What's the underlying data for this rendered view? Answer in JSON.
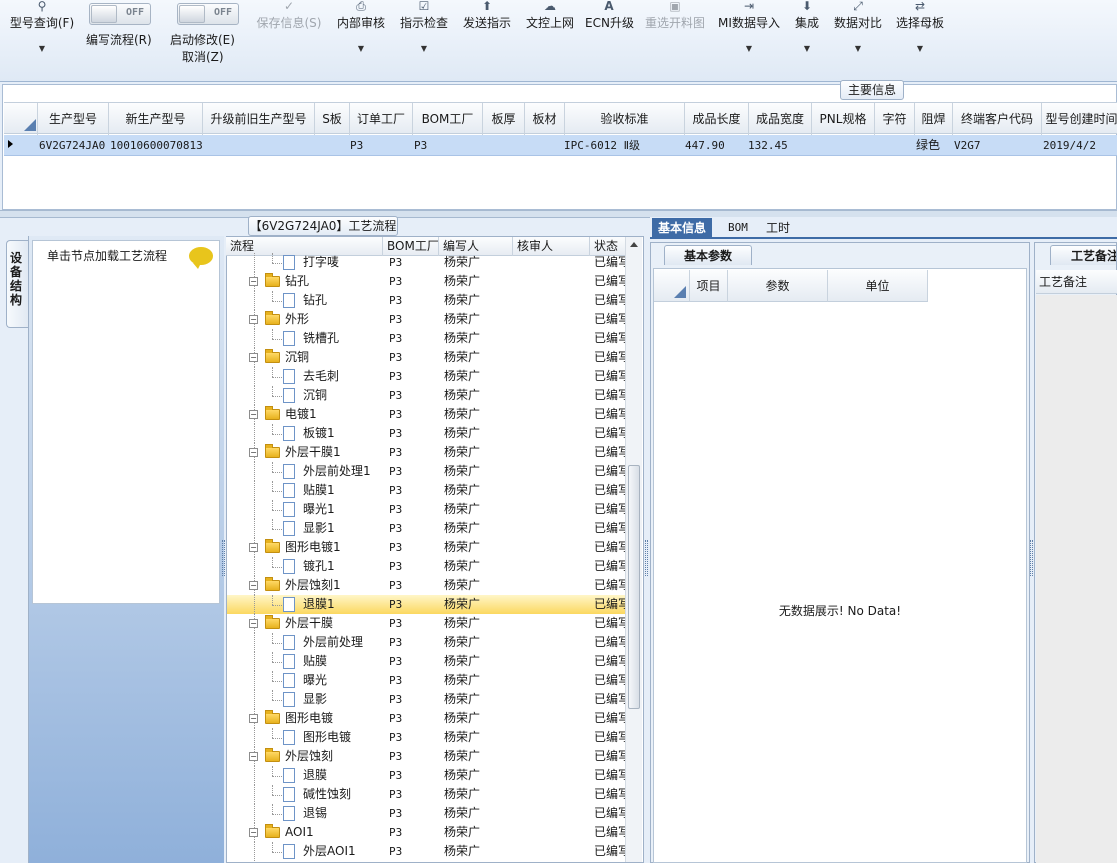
{
  "toolbar": {
    "query_model": "型号查询(F)",
    "write_flow_label": "编写流程(R)",
    "write_flow_toggle": "OFF",
    "start_modify_label": "启动修改(E)",
    "start_modify_toggle": "OFF",
    "cancel": "取消(Z)",
    "save_info": "保存信息(S)",
    "internal_review": "内部审核",
    "instruction_check": "指示检查",
    "send_instruction": "发送指示",
    "control_upload": "文控上网",
    "ecn_upgrade": "ECN升级",
    "reselect_cutting": "重选开料图",
    "mi_import": "MI数据导入",
    "integrate": "集成",
    "data_compare": "数据对比",
    "select_master": "选择母板"
  },
  "main_info": {
    "title": "主要信息",
    "columns": [
      "生产型号",
      "新生产型号",
      "升级前旧生产型号",
      "S板",
      "订单工厂",
      "BOM工厂",
      "板厚",
      "板材",
      "验收标准",
      "成品长度",
      "成品宽度",
      "PNL规格",
      "字符",
      "阻焊",
      "终端客户代码",
      "型号创建时间"
    ],
    "row": [
      "6V2G724JA0",
      "10010600070813",
      "",
      "",
      "P3",
      "P3",
      "",
      "",
      "IPC-6012 Ⅱ级",
      "447.90",
      "132.45",
      "",
      "",
      "绿色",
      "V2G7",
      "2019/4/2"
    ]
  },
  "left": {
    "vertical_tab": "设备结构",
    "hint": "单击节点加载工艺流程"
  },
  "flow": {
    "title": "【6V2G724JA0】工艺流程",
    "columns": [
      "流程",
      "BOM工厂",
      "编写人",
      "核审人",
      "状态"
    ],
    "rows": [
      {
        "name": "打字唛",
        "level": 2,
        "bom": "P3",
        "writer": "杨荣广",
        "reviewer": "",
        "status": "已编写"
      },
      {
        "name": "钻孔",
        "level": 1,
        "bom": "P3",
        "writer": "杨荣广",
        "reviewer": "",
        "status": "已编写"
      },
      {
        "name": "钻孔",
        "level": 2,
        "bom": "P3",
        "writer": "杨荣广",
        "reviewer": "",
        "status": "已编写"
      },
      {
        "name": "外形",
        "level": 1,
        "bom": "P3",
        "writer": "杨荣广",
        "reviewer": "",
        "status": "已编写"
      },
      {
        "name": "铣槽孔",
        "level": 2,
        "bom": "P3",
        "writer": "杨荣广",
        "reviewer": "",
        "status": "已编写"
      },
      {
        "name": "沉铜",
        "level": 1,
        "bom": "P3",
        "writer": "杨荣广",
        "reviewer": "",
        "status": "已编写"
      },
      {
        "name": "去毛刺",
        "level": 2,
        "bom": "P3",
        "writer": "杨荣广",
        "reviewer": "",
        "status": "已编写"
      },
      {
        "name": "沉铜",
        "level": 2,
        "bom": "P3",
        "writer": "杨荣广",
        "reviewer": "",
        "status": "已编写"
      },
      {
        "name": "电镀1",
        "level": 1,
        "bom": "P3",
        "writer": "杨荣广",
        "reviewer": "",
        "status": "已编写"
      },
      {
        "name": "板镀1",
        "level": 2,
        "bom": "P3",
        "writer": "杨荣广",
        "reviewer": "",
        "status": "已编写"
      },
      {
        "name": "外层干膜1",
        "level": 1,
        "bom": "P3",
        "writer": "杨荣广",
        "reviewer": "",
        "status": "已编写"
      },
      {
        "name": "外层前处理1",
        "level": 2,
        "bom": "P3",
        "writer": "杨荣广",
        "reviewer": "",
        "status": "已编写"
      },
      {
        "name": "贴膜1",
        "level": 2,
        "bom": "P3",
        "writer": "杨荣广",
        "reviewer": "",
        "status": "已编写"
      },
      {
        "name": "曝光1",
        "level": 2,
        "bom": "P3",
        "writer": "杨荣广",
        "reviewer": "",
        "status": "已编写"
      },
      {
        "name": "显影1",
        "level": 2,
        "bom": "P3",
        "writer": "杨荣广",
        "reviewer": "",
        "status": "已编写"
      },
      {
        "name": "图形电镀1",
        "level": 1,
        "bom": "P3",
        "writer": "杨荣广",
        "reviewer": "",
        "status": "已编写"
      },
      {
        "name": "镀孔1",
        "level": 2,
        "bom": "P3",
        "writer": "杨荣广",
        "reviewer": "",
        "status": "已编写"
      },
      {
        "name": "外层蚀刻1",
        "level": 1,
        "bom": "P3",
        "writer": "杨荣广",
        "reviewer": "",
        "status": "已编写"
      },
      {
        "name": "退膜1",
        "level": 2,
        "bom": "P3",
        "writer": "杨荣广",
        "reviewer": "",
        "status": "已编写",
        "selected": true
      },
      {
        "name": "外层干膜",
        "level": 1,
        "bom": "P3",
        "writer": "杨荣广",
        "reviewer": "",
        "status": "已编写"
      },
      {
        "name": "外层前处理",
        "level": 2,
        "bom": "P3",
        "writer": "杨荣广",
        "reviewer": "",
        "status": "已编写"
      },
      {
        "name": "贴膜",
        "level": 2,
        "bom": "P3",
        "writer": "杨荣广",
        "reviewer": "",
        "status": "已编写"
      },
      {
        "name": "曝光",
        "level": 2,
        "bom": "P3",
        "writer": "杨荣广",
        "reviewer": "",
        "status": "已编写"
      },
      {
        "name": "显影",
        "level": 2,
        "bom": "P3",
        "writer": "杨荣广",
        "reviewer": "",
        "status": "已编写"
      },
      {
        "name": "图形电镀",
        "level": 1,
        "bom": "P3",
        "writer": "杨荣广",
        "reviewer": "",
        "status": "已编写"
      },
      {
        "name": "图形电镀",
        "level": 2,
        "bom": "P3",
        "writer": "杨荣广",
        "reviewer": "",
        "status": "已编写"
      },
      {
        "name": "外层蚀刻",
        "level": 1,
        "bom": "P3",
        "writer": "杨荣广",
        "reviewer": "",
        "status": "已编写"
      },
      {
        "name": "退膜",
        "level": 2,
        "bom": "P3",
        "writer": "杨荣广",
        "reviewer": "",
        "status": "已编写"
      },
      {
        "name": "碱性蚀刻",
        "level": 2,
        "bom": "P3",
        "writer": "杨荣广",
        "reviewer": "",
        "status": "已编写"
      },
      {
        "name": "退锡",
        "level": 2,
        "bom": "P3",
        "writer": "杨荣广",
        "reviewer": "",
        "status": "已编写"
      },
      {
        "name": "AOI1",
        "level": 1,
        "bom": "P3",
        "writer": "杨荣广",
        "reviewer": "",
        "status": "已编写"
      },
      {
        "name": "外层AOI1",
        "level": 2,
        "bom": "P3",
        "writer": "杨荣广",
        "reviewer": "",
        "status": "已编写"
      }
    ]
  },
  "right": {
    "tabs": [
      "基本信息",
      "BOM",
      "工时"
    ],
    "basic_params_title": "基本参数",
    "basic_columns": [
      "项目",
      "参数",
      "单位"
    ],
    "no_data": "无数据展示! No Data!",
    "remark_title": "工艺备注",
    "remark_column": "工艺备注"
  }
}
